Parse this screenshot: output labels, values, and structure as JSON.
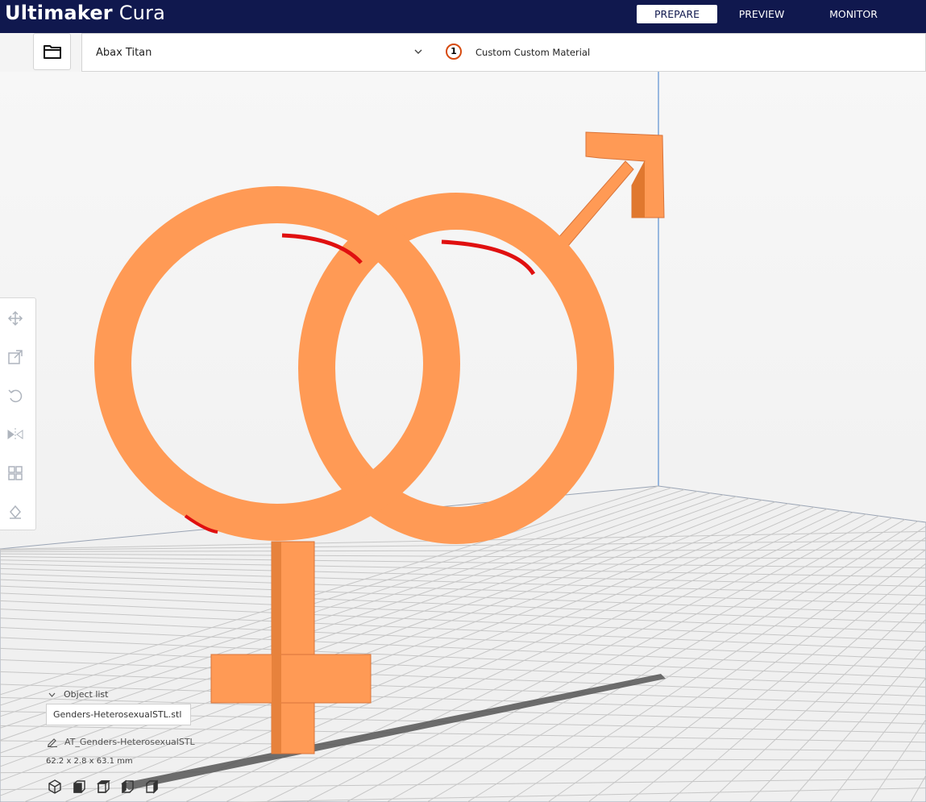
{
  "app": {
    "brand_bold": "Ultimaker",
    "brand_light": "Cura"
  },
  "stages": {
    "prepare": "PREPARE",
    "preview": "PREVIEW",
    "monitor": "MONITOR"
  },
  "printer": {
    "name": "Abax Titan"
  },
  "material": {
    "extruder_number": "1",
    "name": "Custom Custom Material"
  },
  "object_panel": {
    "toggle_label": "Object list",
    "file_name": "Genders-HeterosexualSTL.stl",
    "object_name": "AT_Genders-HeterosexualSTL",
    "dimensions": "62.2 x 2.8 x 63.1 mm"
  },
  "colors": {
    "topbar": "#10184e",
    "model": "#ff9a55",
    "overhang": "#e01010",
    "grid": "#c8c8c8"
  },
  "icons": [
    "folder-icon",
    "chevron-down-icon",
    "move-icon",
    "scale-icon",
    "rotate-icon",
    "mirror-icon",
    "per-model-settings-icon",
    "support-blocker-icon",
    "pencil-icon",
    "view-3d-icon",
    "view-front-icon",
    "view-top-icon",
    "view-left-icon",
    "view-right-icon"
  ]
}
